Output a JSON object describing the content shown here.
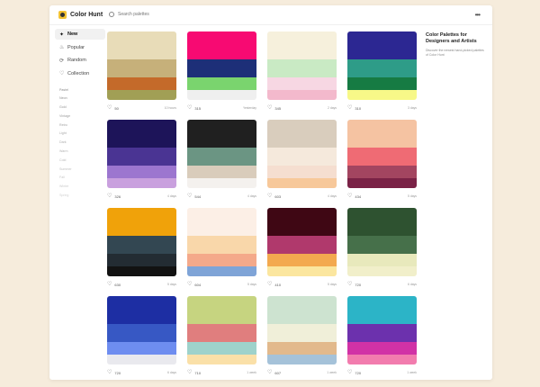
{
  "app": {
    "name": "Color Hunt"
  },
  "search": {
    "placeholder": "Search palettes"
  },
  "header": {
    "more_icon": "more-icon"
  },
  "sidebar": {
    "nav": [
      {
        "label": "New",
        "icon": "sparkle-icon",
        "active": true
      },
      {
        "label": "Popular",
        "icon": "flame-icon",
        "active": false
      },
      {
        "label": "Random",
        "icon": "shuffle-icon",
        "active": false
      },
      {
        "label": "Collection",
        "icon": "heart-icon",
        "active": false
      }
    ],
    "tags": [
      "Pastel",
      "Neon",
      "Gold",
      "Vintage",
      "Retro",
      "Light",
      "Dark",
      "Warm",
      "Cold",
      "Summer",
      "Fall",
      "Winter",
      "Spring"
    ]
  },
  "info": {
    "title": "Color Palettes for Designers and Artists",
    "description": "Discover the newest hand-picked palettes of Color Hunt"
  },
  "palettes": [
    {
      "colors": [
        "#e8dcb8",
        "#c6b07a",
        "#c46a2a",
        "#a19f55"
      ],
      "likes": "50",
      "age": "10 hours"
    },
    {
      "colors": [
        "#f70a72",
        "#1d2f78",
        "#7ad46e",
        "#efefef"
      ],
      "likes": "315",
      "age": "Yesterday"
    },
    {
      "colors": [
        "#f6f0dc",
        "#c9eac4",
        "#f7d7e3",
        "#f3b9cc"
      ],
      "likes": "345",
      "age": "2 days"
    },
    {
      "colors": [
        "#2c2792",
        "#2e9c88",
        "#167b43",
        "#f7f888"
      ],
      "likes": "310",
      "age": "3 days"
    },
    {
      "colors": [
        "#1d1459",
        "#4a3493",
        "#9c76cf",
        "#c9a0de"
      ],
      "likes": "326",
      "age": "4 days"
    },
    {
      "colors": [
        "#202020",
        "#6b9583",
        "#d9ccbb",
        "#f4f1ee"
      ],
      "likes": "544",
      "age": "4 days"
    },
    {
      "colors": [
        "#d9cdbd",
        "#f5e9dc",
        "#f5ded0",
        "#f7c89a"
      ],
      "likes": "603",
      "age": "4 days"
    },
    {
      "colors": [
        "#f5c3a2",
        "#ef6b74",
        "#a34560",
        "#7a2246"
      ],
      "likes": "434",
      "age": "5 days"
    },
    {
      "colors": [
        "#f0a20a",
        "#334752",
        "#232c33",
        "#121212"
      ],
      "likes": "630",
      "age": "5 days"
    },
    {
      "colors": [
        "#fcefe6",
        "#f9d7aa",
        "#f4a98a",
        "#7fa4d7"
      ],
      "likes": "604",
      "age": "5 days"
    },
    {
      "colors": [
        "#3f0714",
        "#b0396c",
        "#f3a94f",
        "#fbe69f"
      ],
      "likes": "410",
      "age": "5 days"
    },
    {
      "colors": [
        "#2e5230",
        "#46704a",
        "#e8e9bc",
        "#f1efca"
      ],
      "likes": "720",
      "age": "6 days"
    },
    {
      "colors": [
        "#1d2ea3",
        "#3758c4",
        "#6e8df0",
        "#e9e9ee"
      ],
      "likes": "720",
      "age": "6 days"
    },
    {
      "colors": [
        "#c6d480",
        "#e07e7e",
        "#9ed2cb",
        "#fae0a8"
      ],
      "likes": "710",
      "age": "1 week"
    },
    {
      "colors": [
        "#cde3d0",
        "#f0efd9",
        "#e2b98c",
        "#a5c2d9"
      ],
      "likes": "607",
      "age": "1 week"
    },
    {
      "colors": [
        "#2cb4c7",
        "#6c31ad",
        "#d132a6",
        "#f27cae"
      ],
      "likes": "720",
      "age": "1 week"
    }
  ]
}
